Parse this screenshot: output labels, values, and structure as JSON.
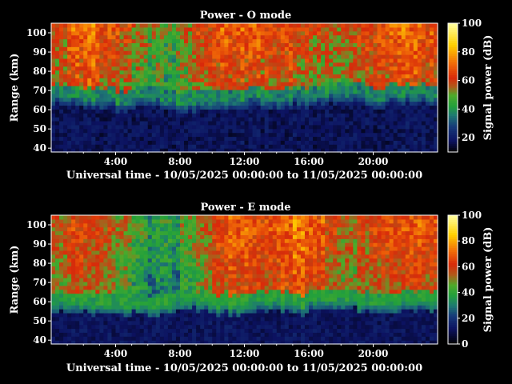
{
  "chart_data": [
    {
      "type": "heatmap",
      "title": "Power - O mode",
      "xlabel": "Universal time - 10/05/2025 00:00:00 to 11/05/2025 00:00:00",
      "ylabel": "Range (km)",
      "xlim": [
        0,
        24
      ],
      "ylim": [
        38,
        105
      ],
      "x_tick_labels": [
        "4:00",
        "8:00",
        "12:00",
        "16:00",
        "20:00"
      ],
      "x_tick_values": [
        4,
        8,
        12,
        16,
        20
      ],
      "y_tick_values": [
        40,
        50,
        60,
        70,
        80,
        90,
        100
      ],
      "colorbar": {
        "label": "Signal power (dB)",
        "range": [
          10,
          100
        ],
        "ticks": [
          20,
          40,
          60,
          80,
          100
        ]
      },
      "boundary_km": [
        67,
        66,
        65,
        65,
        64,
        65,
        66,
        64,
        63,
        63,
        64,
        65,
        66,
        64,
        65,
        66,
        67,
        68,
        68,
        67,
        66,
        67,
        68,
        67
      ],
      "layer_power_db": [
        55,
        62,
        65,
        58,
        55,
        48,
        45,
        42,
        48,
        55,
        60,
        62,
        62,
        58,
        60,
        55,
        52,
        50,
        52,
        58,
        60,
        62,
        64,
        60
      ],
      "colormap": [
        {
          "v": 10,
          "c": "#000000"
        },
        {
          "v": 18,
          "c": "#0c1260"
        },
        {
          "v": 28,
          "c": "#163a7a"
        },
        {
          "v": 36,
          "c": "#1e7a72"
        },
        {
          "v": 42,
          "c": "#22a03c"
        },
        {
          "v": 50,
          "c": "#4eaa2a"
        },
        {
          "v": 56,
          "c": "#b05a1a"
        },
        {
          "v": 62,
          "c": "#d82a0a"
        },
        {
          "v": 72,
          "c": "#f06a08"
        },
        {
          "v": 85,
          "c": "#ffd000"
        },
        {
          "v": 100,
          "c": "#ffffa0"
        }
      ]
    },
    {
      "type": "heatmap",
      "title": "Power - E mode",
      "xlabel": "Universal time - 10/05/2025 00:00:00 to 11/05/2025 00:00:00",
      "ylabel": "Range (km)",
      "xlim": [
        0,
        24
      ],
      "ylim": [
        38,
        105
      ],
      "x_tick_labels": [
        "4:00",
        "8:00",
        "12:00",
        "16:00",
        "20:00"
      ],
      "x_tick_values": [
        4,
        8,
        12,
        16,
        20
      ],
      "y_tick_values": [
        40,
        50,
        60,
        70,
        80,
        90,
        100
      ],
      "colorbar": {
        "label": "Signal power (dB)",
        "range": [
          0,
          100
        ],
        "ticks": [
          0,
          20,
          40,
          60,
          80,
          100
        ]
      },
      "boundary_km": [
        60,
        59,
        58,
        58,
        57,
        58,
        58,
        59,
        60,
        59,
        58,
        58,
        59,
        60,
        59,
        58,
        60,
        61,
        60,
        59,
        58,
        59,
        60,
        60
      ],
      "layer_power_db": [
        50,
        55,
        52,
        50,
        42,
        35,
        30,
        30,
        40,
        45,
        55,
        60,
        60,
        58,
        62,
        65,
        60,
        52,
        48,
        52,
        55,
        58,
        60,
        58
      ],
      "colormap": [
        {
          "v": 0,
          "c": "#000000"
        },
        {
          "v": 12,
          "c": "#0c1260"
        },
        {
          "v": 22,
          "c": "#163a7a"
        },
        {
          "v": 30,
          "c": "#1e7a72"
        },
        {
          "v": 38,
          "c": "#22a03c"
        },
        {
          "v": 46,
          "c": "#4eaa2a"
        },
        {
          "v": 54,
          "c": "#b05a1a"
        },
        {
          "v": 62,
          "c": "#d82a0a"
        },
        {
          "v": 72,
          "c": "#f06a08"
        },
        {
          "v": 85,
          "c": "#ffd000"
        },
        {
          "v": 100,
          "c": "#ffffa0"
        }
      ]
    }
  ]
}
